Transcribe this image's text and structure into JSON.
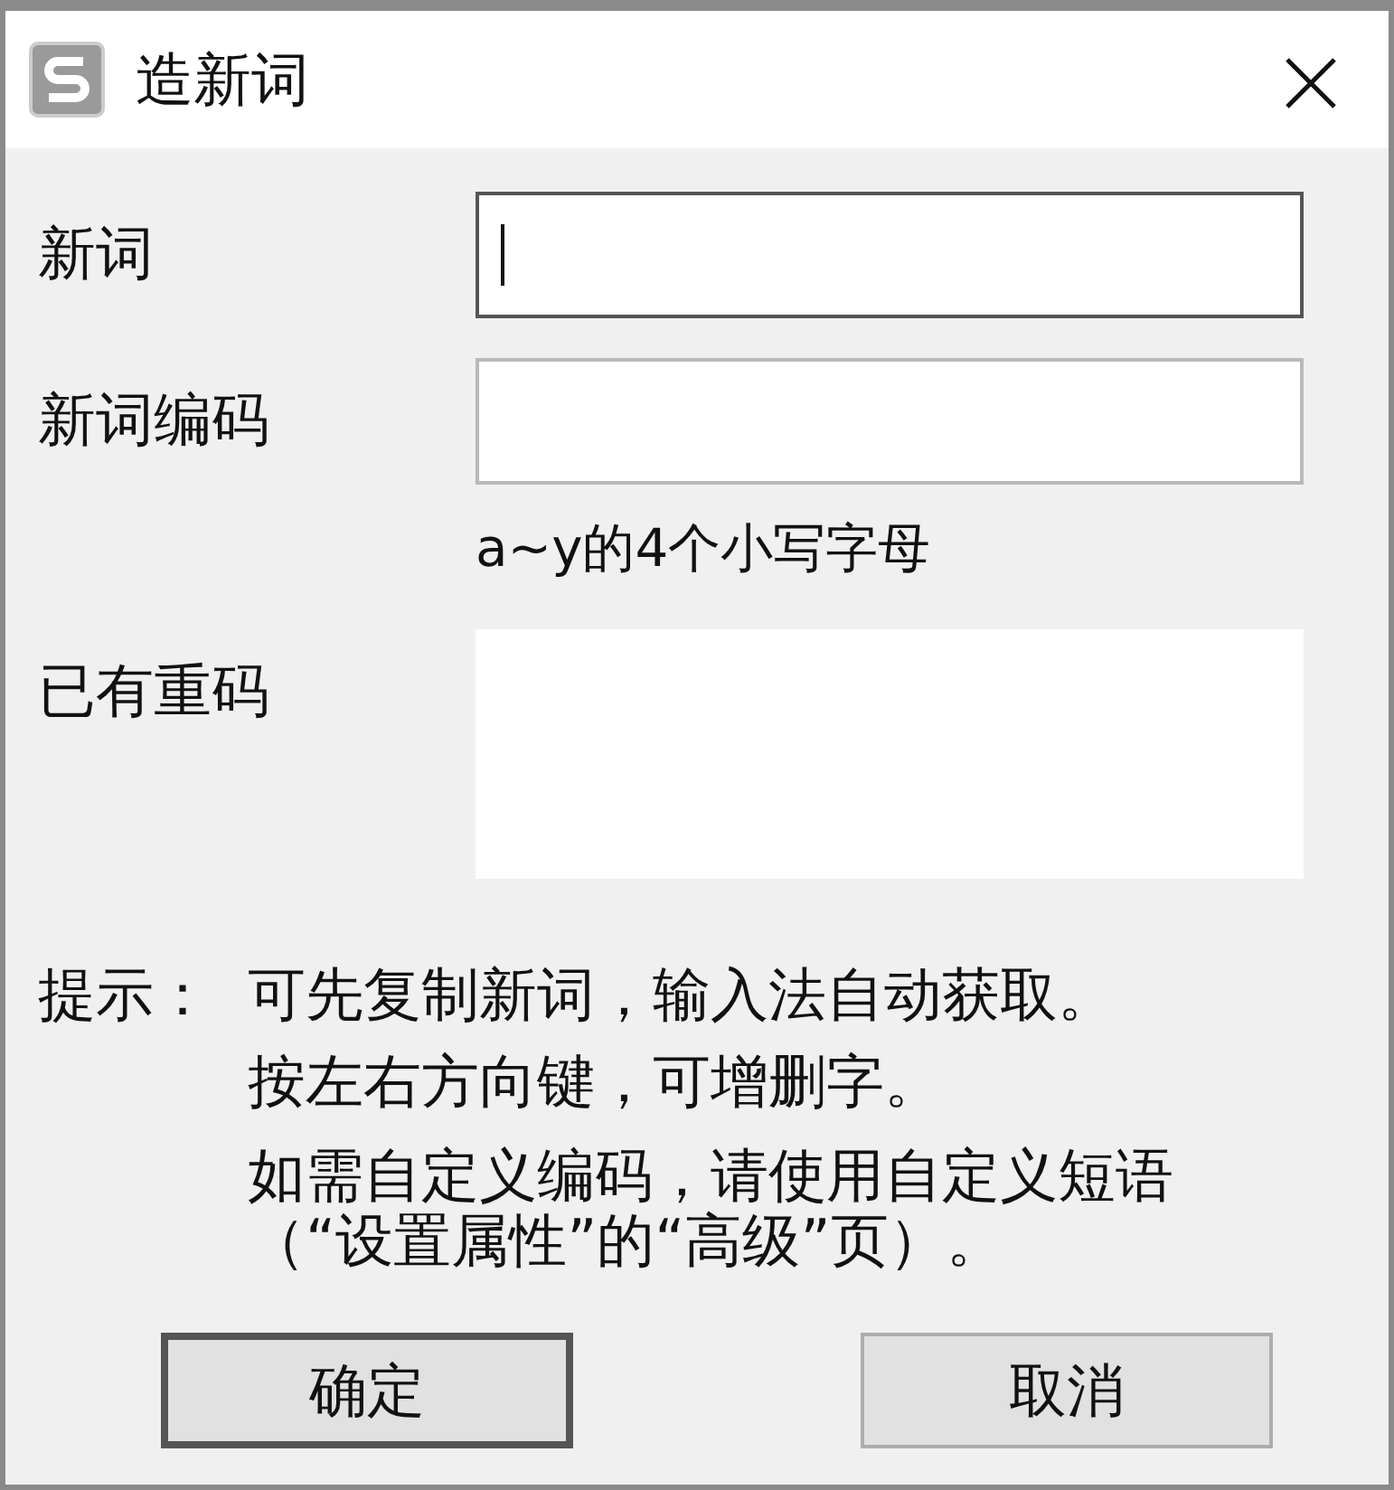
{
  "window": {
    "title": "造新词"
  },
  "fields": [
    {
      "label": "新词",
      "kind": "single",
      "focused": true
    },
    {
      "label": "新词编码",
      "kind": "single",
      "focused": false,
      "hint": "a~y的4个小写字母"
    },
    {
      "label": "已有重码",
      "kind": "multiline",
      "focused": false
    }
  ],
  "tip": {
    "label": "提示：",
    "lines": [
      "可先复制新词，输入法自动获取。",
      "按左右方向键，可增删字。"
    ],
    "note": "如需自定义编码，请使用自定义短语（“设置属性”的“高级”页）。"
  },
  "buttons": [
    {
      "label": "确定",
      "default": true
    },
    {
      "label": "取消",
      "default": false
    }
  ]
}
